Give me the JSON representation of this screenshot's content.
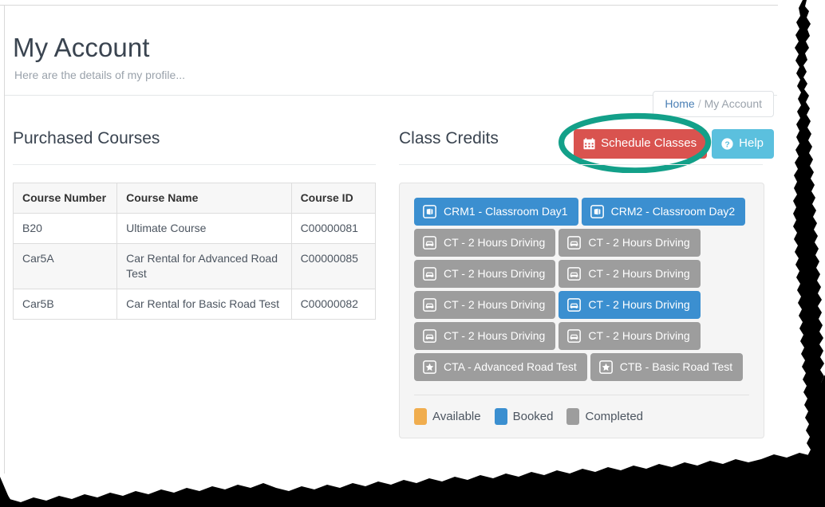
{
  "header": {
    "title": "My Account",
    "subtitle": "Here are the details of my profile..."
  },
  "breadcrumb": {
    "home": "Home",
    "separator": "/",
    "current": "My Account"
  },
  "left": {
    "section_title": "Purchased Courses",
    "table": {
      "columns": [
        "Course Number",
        "Course Name",
        "Course ID"
      ],
      "rows": [
        [
          "B20",
          "Ultimate Course",
          "C00000081"
        ],
        [
          "Car5A",
          "Car Rental for Advanced Road Test",
          "C00000085"
        ],
        [
          "Car5B",
          "Car Rental for Basic Road Test",
          "C00000082"
        ]
      ]
    }
  },
  "right": {
    "section_title": "Class Credits"
  },
  "actions": {
    "schedule": {
      "label": "Schedule Classes",
      "icon": "calendar-icon",
      "color": "#d9534f"
    },
    "help": {
      "label": "Help",
      "icon": "question-circle-icon",
      "color": "#5bc0de"
    }
  },
  "annotation": {
    "shape": "ellipse-highlight",
    "color": "#13a089",
    "target": "schedule-classes-button"
  },
  "credits": {
    "rows": [
      [
        {
          "label": "CRM1 - Classroom Day1",
          "icon": "classroom-icon",
          "state": "booked"
        },
        {
          "label": "CRM2 - Classroom Day2",
          "icon": "classroom-icon",
          "state": "booked"
        }
      ],
      [
        {
          "label": "CT - 2 Hours Driving",
          "icon": "car-icon",
          "state": "completed"
        },
        {
          "label": "CT - 2 Hours Driving",
          "icon": "car-icon",
          "state": "completed"
        }
      ],
      [
        {
          "label": "CT - 2 Hours Driving",
          "icon": "car-icon",
          "state": "completed"
        },
        {
          "label": "CT - 2 Hours Driving",
          "icon": "car-icon",
          "state": "completed"
        }
      ],
      [
        {
          "label": "CT - 2 Hours Driving",
          "icon": "car-icon",
          "state": "completed"
        },
        {
          "label": "CT - 2 Hours Driving",
          "icon": "car-icon",
          "state": "booked"
        }
      ],
      [
        {
          "label": "CT - 2 Hours Driving",
          "icon": "car-icon",
          "state": "completed"
        },
        {
          "label": "CT - 2 Hours Driving",
          "icon": "car-icon",
          "state": "completed"
        }
      ],
      [
        {
          "label": "CTA - Advanced Road Test",
          "icon": "star-icon",
          "state": "completed"
        },
        {
          "label": "CTB - Basic Road Test",
          "icon": "star-icon",
          "state": "completed"
        }
      ]
    ],
    "legend": [
      {
        "label": "Available",
        "color": "#f0ad4e"
      },
      {
        "label": "Booked",
        "color": "#3b8fd0"
      },
      {
        "label": "Completed",
        "color": "#9d9d9d"
      }
    ]
  },
  "colors": {
    "booked": "#3b8fd0",
    "completed": "#9d9d9d",
    "available": "#f0ad4e",
    "danger": "#d9534f",
    "info": "#5bc0de",
    "annotation": "#13a089",
    "panel_bg": "#f5f5f5"
  }
}
